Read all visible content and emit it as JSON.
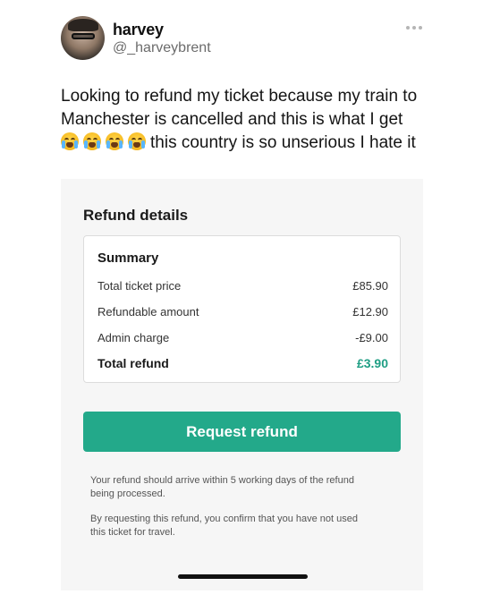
{
  "tweet": {
    "user_name": "harvey",
    "user_handle": "@_harveybrent",
    "text_line1": "Looking to refund my ticket because my train to",
    "text_line2": "Manchester is cancelled and this is what I get",
    "text_line3": "this country is so unserious I hate it",
    "emojis": [
      "loudly-crying-face-icon",
      "loudly-crying-face-icon",
      "loudly-crying-face-icon",
      "loudly-crying-face-icon"
    ]
  },
  "screenshot": {
    "title": "Refund details",
    "summary": {
      "heading": "Summary",
      "rows": [
        {
          "label": "Total ticket price",
          "value": "£85.90"
        },
        {
          "label": "Refundable amount",
          "value": "£12.90"
        },
        {
          "label": "Admin charge",
          "value": "-£9.00"
        }
      ],
      "total": {
        "label": "Total refund",
        "value": "£3.90"
      }
    },
    "button_label": "Request refund",
    "note1_line1": "Your refund should arrive within 5 working days of the refund",
    "note1_line2": "being processed.",
    "note2_line1": "By requesting this refund, you confirm that you have not used",
    "note2_line2": "this ticket for travel."
  },
  "colors": {
    "accent": "#23a98a",
    "total_value": "#1f9e84"
  }
}
